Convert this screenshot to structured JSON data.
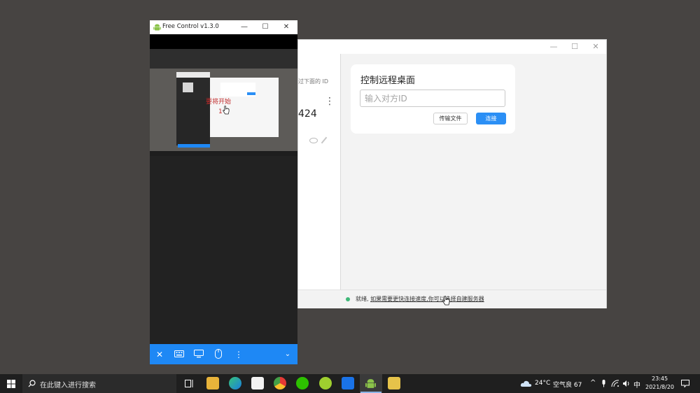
{
  "remote_desktop": {
    "left_panel": {
      "hint_text": "过下面的 ID",
      "id_fragment": "424",
      "more_glyph": "⋮"
    },
    "card": {
      "title": "控制远程桌面",
      "id_placeholder": "输入对方ID",
      "file_transfer_label": "传输文件",
      "connect_label": "连接"
    },
    "status": {
      "ready": "就绪,",
      "link_text": "如果需要更快连接速度,你可以选择自建服务器"
    }
  },
  "free_control": {
    "title": "Free Control v1.3.0",
    "mirror_red_text": "要将开始",
    "mirror_red_text2": "1"
  },
  "taskbar": {
    "search_placeholder": "在此键入进行搜索",
    "weather": "24°C",
    "air_quality": "空气良 67",
    "ime": "中",
    "time": "23:45",
    "date": "2021/8/20"
  },
  "colors": {
    "accent_blue": "#1e88f5",
    "connect_button": "#2b8ff5",
    "status_green": "#3fb878"
  }
}
